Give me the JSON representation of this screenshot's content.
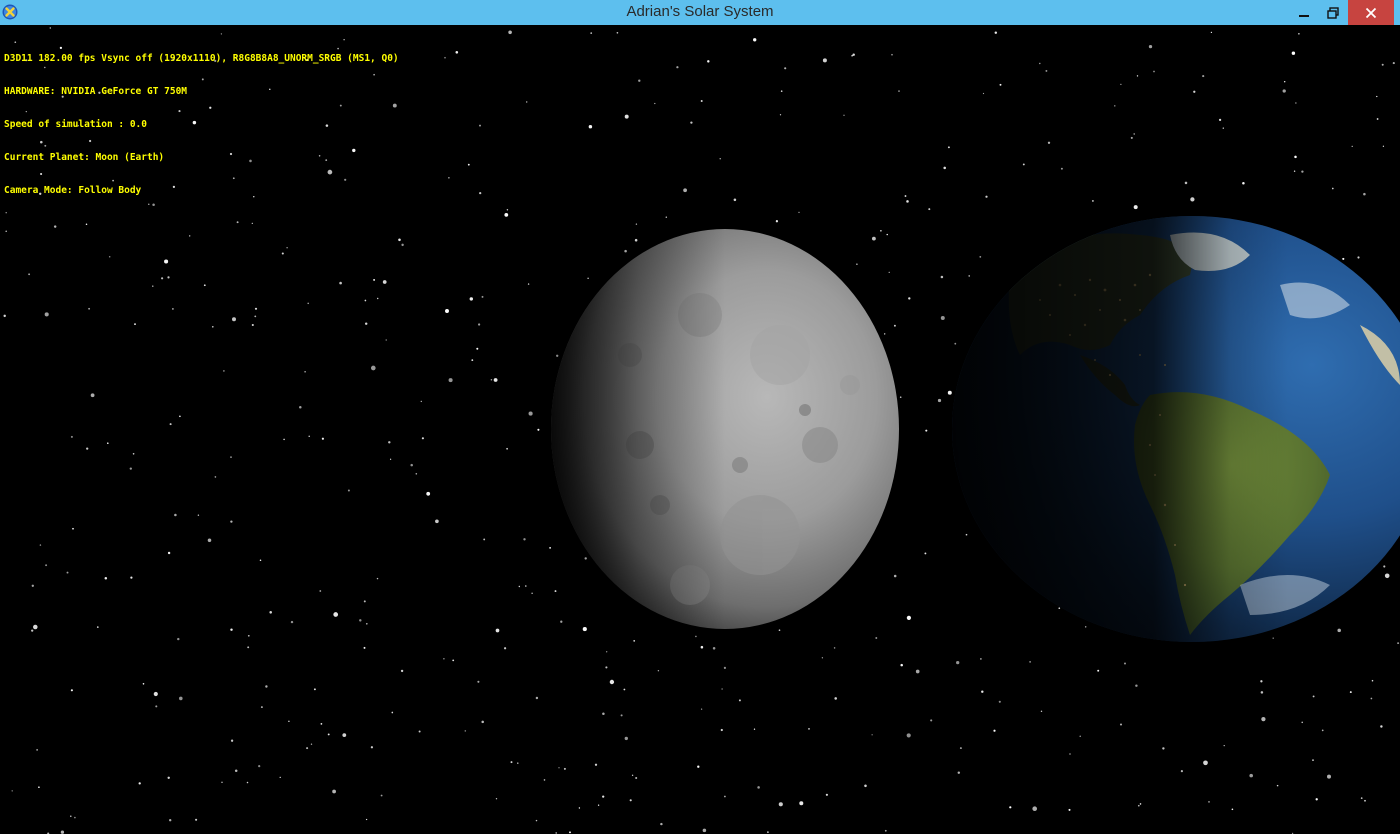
{
  "window": {
    "title": "Adrian's Solar System",
    "icon": "app-x-icon",
    "controls": {
      "minimize": "minimize-icon",
      "maximize": "restore-icon",
      "close": "close-icon"
    }
  },
  "hud": {
    "line1": "D3D11 182.00 fps Vsync off (1920x1110), R8G8B8A8_UNORM_SRGB (MS1, Q0)",
    "line2": "HARDWARE: NVIDIA GeForce GT 750M",
    "line3": "Speed of simulation : 0.0",
    "line4": "Current Planet: Moon (Earth)",
    "line5": "Camera Mode: Follow Body",
    "color": "#ffff00"
  },
  "scene": {
    "background": "#000000",
    "bodies": [
      "moon",
      "earth"
    ]
  },
  "colors": {
    "titlebar": "#5dbfee",
    "close_button": "#c74440"
  }
}
